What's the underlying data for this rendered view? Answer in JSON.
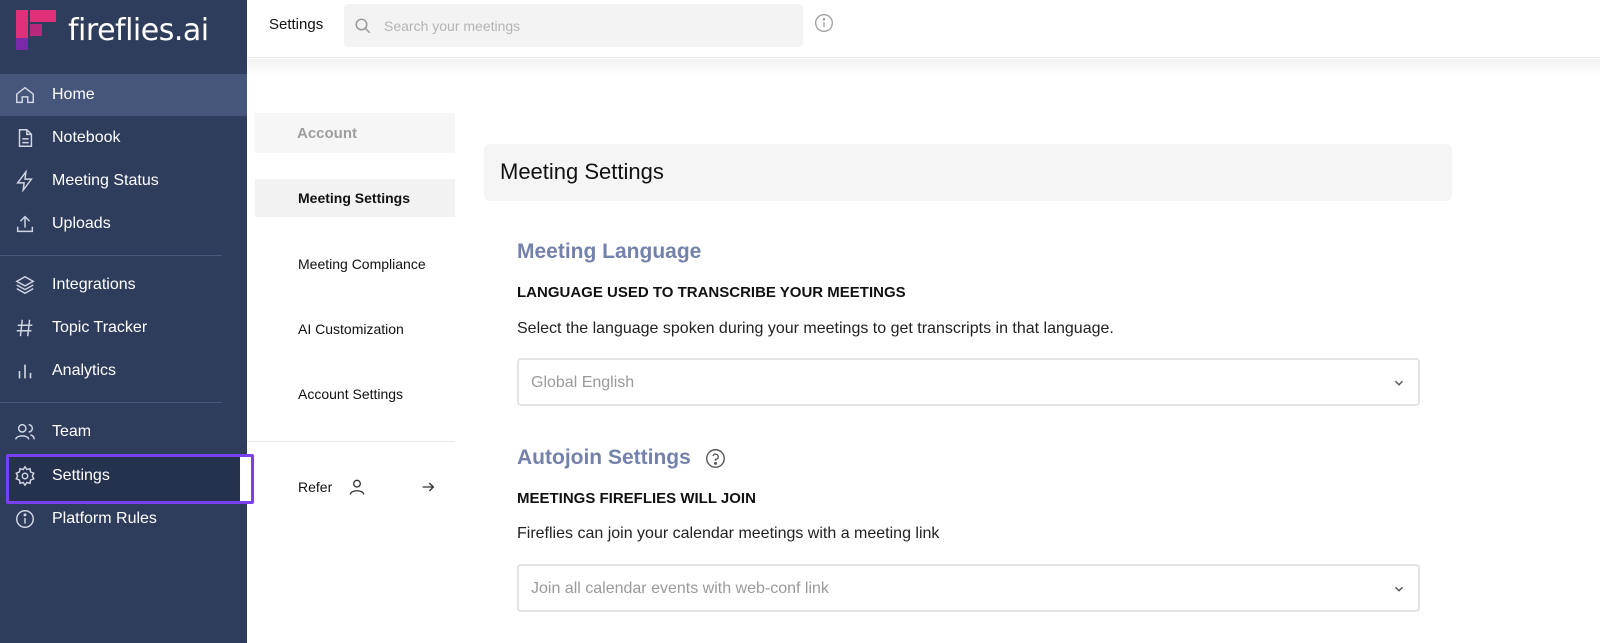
{
  "brand": {
    "name": "fireflies.ai",
    "colors": {
      "sidebar": "#2e3d5c",
      "active": "#46557a",
      "highlight": "#7b3ff2",
      "logo_pink": "#e0307a",
      "logo_purple": "#7a2aa8",
      "section_title": "#7482ab"
    }
  },
  "sidebar": {
    "items": [
      {
        "label": "Home",
        "icon": "home-icon"
      },
      {
        "label": "Notebook",
        "icon": "document-icon"
      },
      {
        "label": "Meeting Status",
        "icon": "lightning-icon"
      },
      {
        "label": "Uploads",
        "icon": "upload-icon"
      },
      {
        "label": "Integrations",
        "icon": "layers-icon"
      },
      {
        "label": "Topic Tracker",
        "icon": "hashtag-icon"
      },
      {
        "label": "Analytics",
        "icon": "bar-chart-icon"
      },
      {
        "label": "Team",
        "icon": "users-icon"
      },
      {
        "label": "Settings",
        "icon": "gear-icon"
      },
      {
        "label": "Platform Rules",
        "icon": "info-icon"
      }
    ]
  },
  "topbar": {
    "title": "Settings",
    "search_placeholder": "Search your meetings"
  },
  "submenu": {
    "group": "Account",
    "items": [
      "Meeting Settings",
      "Meeting Compliance",
      "AI Customization",
      "Account Settings"
    ],
    "refer_label": "Refer"
  },
  "main": {
    "header": "Meeting Settings",
    "language": {
      "title": "Meeting Language",
      "label": "LANGUAGE USED TO TRANSCRIBE YOUR MEETINGS",
      "description": "Select the language spoken during your meetings to get transcripts in that language.",
      "value": "Global English"
    },
    "autojoin": {
      "title": "Autojoin Settings",
      "label": "MEETINGS FIREFLIES WILL JOIN",
      "description": "Fireflies can join your calendar meetings with a meeting link",
      "value": "Join all calendar events with web-conf link"
    }
  }
}
